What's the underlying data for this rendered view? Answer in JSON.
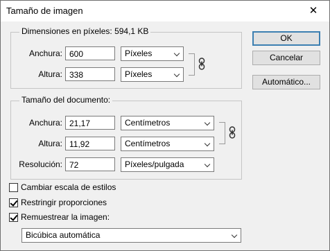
{
  "window": {
    "title": "Tamaño de imagen",
    "close_glyph": "✕"
  },
  "pixel_dimensions": {
    "legend": "Dimensiones en píxeles:  594,1 KB",
    "width_label": "Anchura:",
    "width_value": "600",
    "width_unit": "Píxeles",
    "height_label": "Altura:",
    "height_value": "338",
    "height_unit": "Píxeles"
  },
  "document_size": {
    "legend": "Tamaño del documento:",
    "width_label": "Anchura:",
    "width_value": "21,17",
    "width_unit": "Centímetros",
    "height_label": "Altura:",
    "height_value": "11,92",
    "height_unit": "Centímetros",
    "resolution_label": "Resolución:",
    "resolution_value": "72",
    "resolution_unit": "Píxeles/pulgada"
  },
  "buttons": {
    "ok": "OK",
    "cancel": "Cancelar",
    "auto": "Automático..."
  },
  "options": {
    "scale_styles_label": "Cambiar escala de estilos",
    "scale_styles_checked": false,
    "constrain_label": "Restringir proporciones",
    "constrain_checked": true,
    "resample_label": "Remuestrear la imagen:",
    "resample_checked": true,
    "resample_method": "Bicúbica automática"
  }
}
